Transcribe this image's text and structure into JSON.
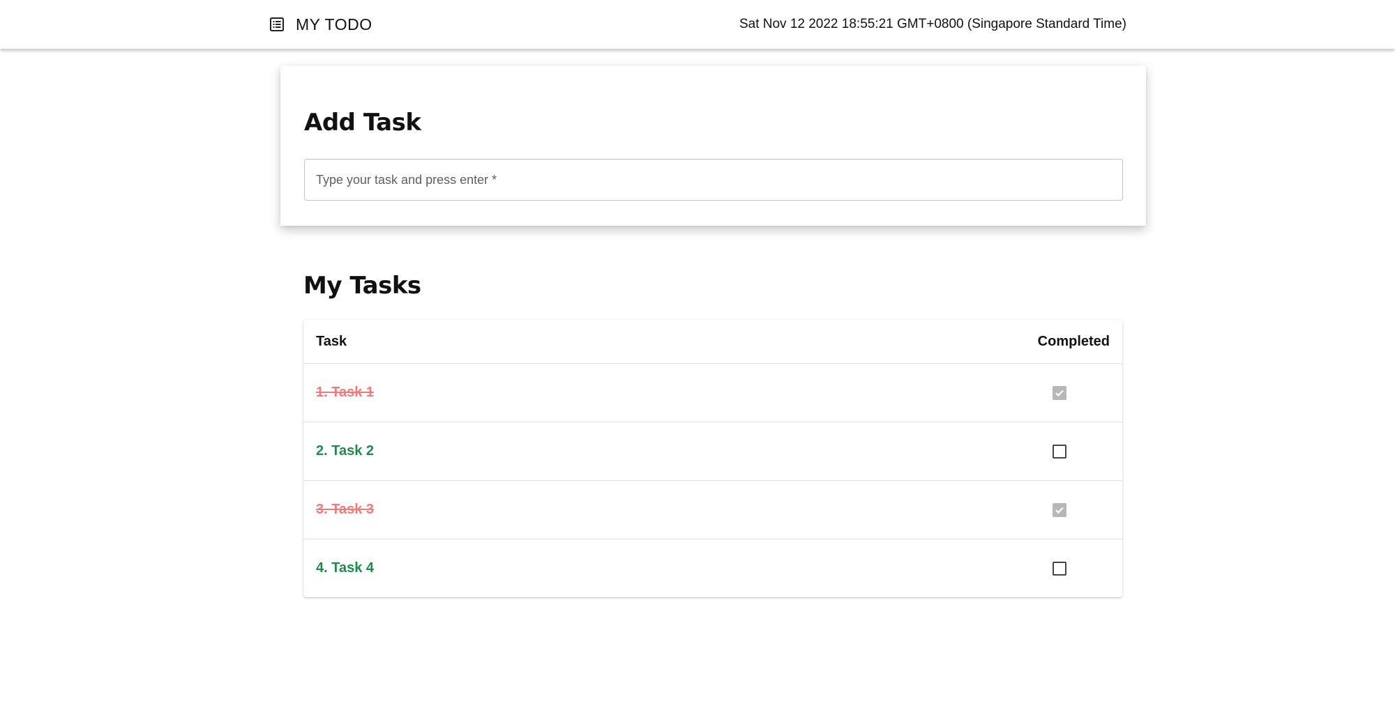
{
  "header": {
    "title": "MY TODO",
    "icon": "list-icon",
    "datetime": "Sat Nov 12 2022 18:55:21 GMT+0800 (Singapore Standard Time)"
  },
  "add_task": {
    "title": "Add Task",
    "placeholder": "Type your task and press enter *",
    "value": ""
  },
  "tasks": {
    "title": "My Tasks",
    "columns": [
      "Task",
      "Completed"
    ],
    "rows": [
      {
        "label": "1. Task 1",
        "completed": true
      },
      {
        "label": "2. Task 2",
        "completed": false
      },
      {
        "label": "3. Task 3",
        "completed": true
      },
      {
        "label": "4. Task 4",
        "completed": false
      }
    ]
  },
  "colors": {
    "completed_text": "#ee7b7b",
    "pending_text": "#1e8a4c",
    "checked_box": "#b7b7b7"
  }
}
